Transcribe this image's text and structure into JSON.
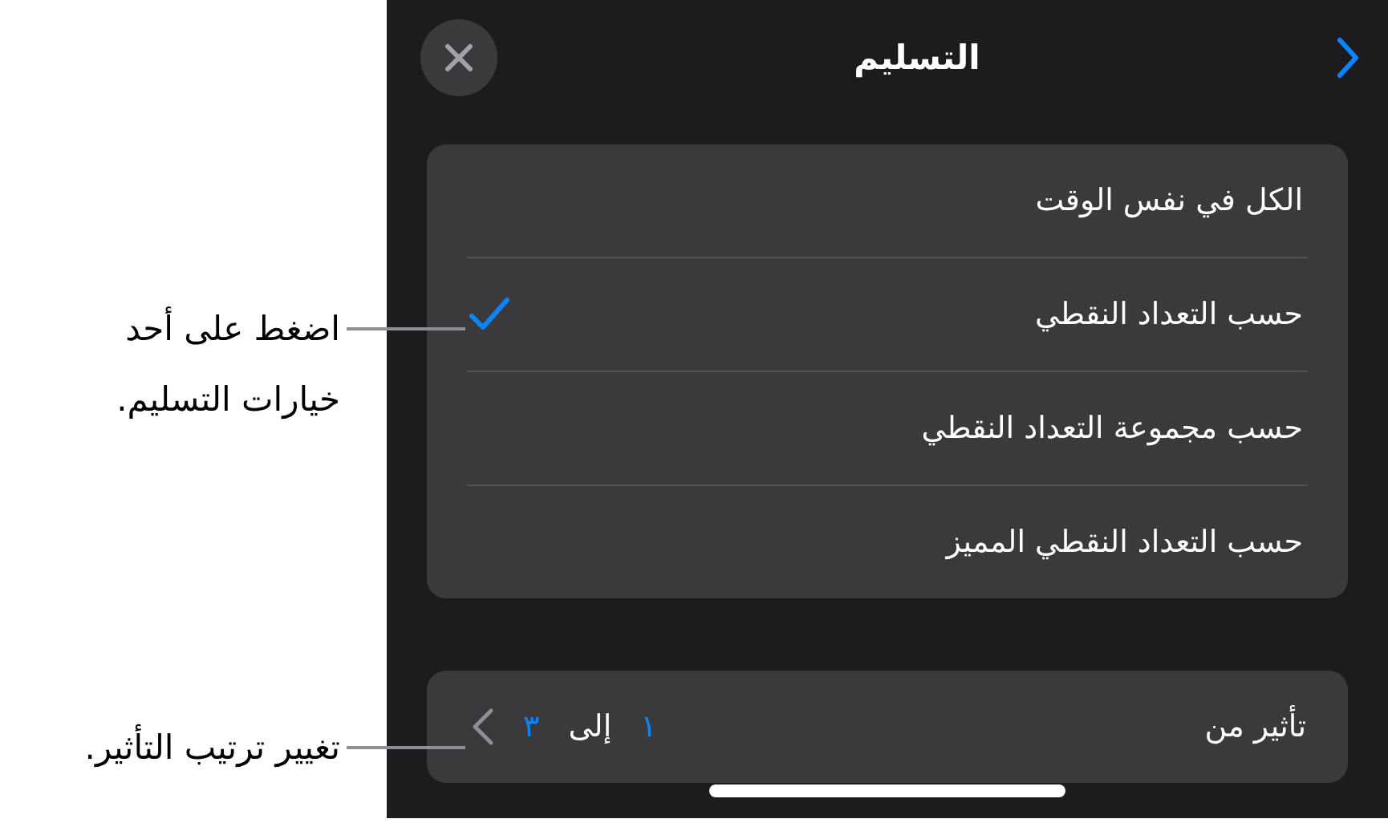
{
  "header": {
    "title": "التسليم"
  },
  "options": [
    {
      "label": "الكل في نفس الوقت",
      "selected": false
    },
    {
      "label": "حسب التعداد النقطي",
      "selected": true
    },
    {
      "label": "حسب مجموعة التعداد النقطي",
      "selected": false
    },
    {
      "label": "حسب التعداد النقطي المميز",
      "selected": false
    }
  ],
  "effect_range": {
    "label": "تأثير من",
    "from": "١",
    "to_label": "إلى",
    "to": "٣"
  },
  "callouts": [
    {
      "text": "اضغط على أحد خيارات التسليم."
    },
    {
      "text": "تغيير ترتيب التأثير."
    }
  ]
}
